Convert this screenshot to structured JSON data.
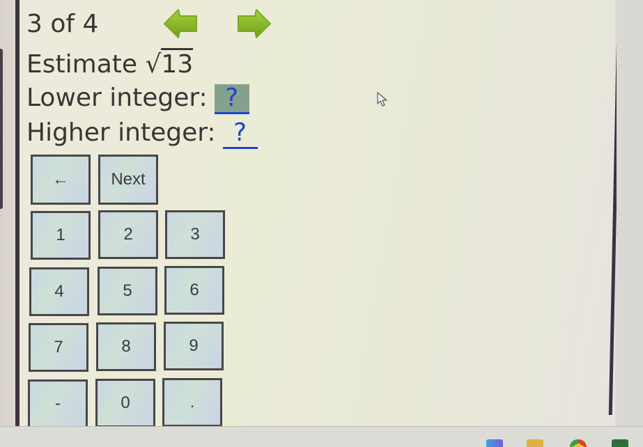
{
  "progress": {
    "current": 3,
    "total": 4,
    "label": "3 of 4"
  },
  "nav": {
    "prev_icon": "green-left-arrow-icon",
    "next_icon": "green-right-arrow-icon",
    "arrow_color": "#8cbf2a"
  },
  "question": {
    "prompt": "Estimate",
    "radical_symbol": "√",
    "radicand": "13",
    "lower_label": "Lower integer:",
    "lower_value": "?",
    "higher_label": "Higher integer:",
    "higher_value": "?",
    "answer_color": "#2244cc",
    "active_field_color": "#85a08c"
  },
  "keypad": {
    "control_row": [
      {
        "label": "←",
        "name": "backspace-button"
      },
      {
        "label": "Next",
        "name": "next-button"
      }
    ],
    "keys": [
      {
        "label": "1"
      },
      {
        "label": "2"
      },
      {
        "label": "3"
      },
      {
        "label": "4"
      },
      {
        "label": "5"
      },
      {
        "label": "6"
      },
      {
        "label": "7"
      },
      {
        "label": "8"
      },
      {
        "label": "9"
      },
      {
        "label": "-"
      },
      {
        "label": "0"
      },
      {
        "label": "."
      }
    ],
    "key_bg": "#c8d8e2"
  },
  "taskbar": {
    "icons": [
      "copilot-icon",
      "file-explorer-icon",
      "chrome-icon",
      "xbox-icon"
    ]
  }
}
